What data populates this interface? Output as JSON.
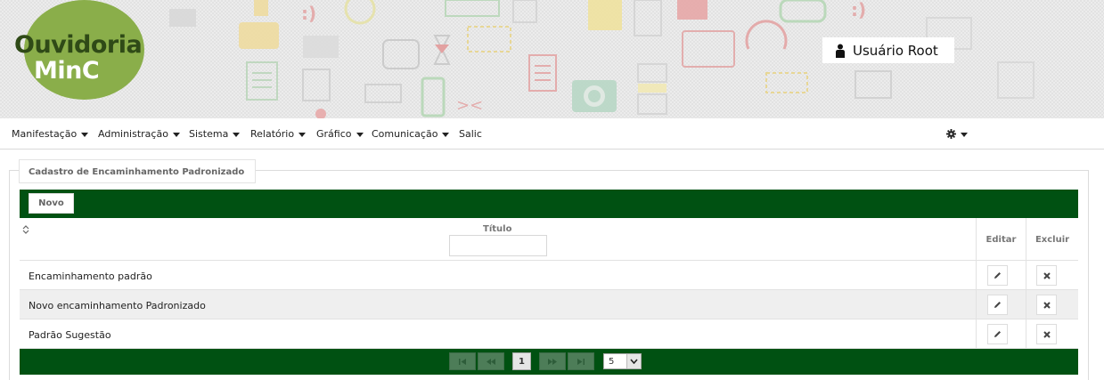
{
  "header": {
    "logo_line1": "Ouvidoria",
    "logo_line2": "MinC",
    "user_name": "Usuário Root"
  },
  "menu": {
    "items": [
      {
        "label": "Manifestação",
        "has_dropdown": true
      },
      {
        "label": "Administração",
        "has_dropdown": true
      },
      {
        "label": "Sistema",
        "has_dropdown": true
      },
      {
        "label": "Relatório",
        "has_dropdown": true
      },
      {
        "label": "Gráfico",
        "has_dropdown": true
      },
      {
        "label": "Comunicação",
        "has_dropdown": true
      },
      {
        "label": "Salic",
        "has_dropdown": false
      }
    ],
    "settings_icon": "gear-icon"
  },
  "panel": {
    "legend": "Cadastro de Encaminhamento Padronizado",
    "new_button": "Novo"
  },
  "table": {
    "columns": {
      "title": "Título",
      "edit": "Editar",
      "delete": "Excluir"
    },
    "filter_value": "",
    "rows": [
      {
        "title": "Encaminhamento padrão"
      },
      {
        "title": "Novo encaminhamento Padronizado"
      },
      {
        "title": "Padrão Sugestão"
      }
    ]
  },
  "pagination": {
    "current_page": "1",
    "rows_per_page": "5"
  },
  "colors": {
    "primary_green": "#005112",
    "logo_green": "#8aae4a",
    "logo_dark": "#2f4a17"
  }
}
